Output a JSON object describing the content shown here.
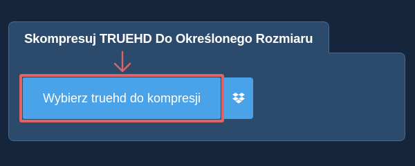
{
  "tab": {
    "title": "Skompresuj TRUEHD Do Określonego Rozmiaru"
  },
  "upload": {
    "button_label": "Wybierz truehd do kompresji"
  },
  "icons": {
    "annotation": "down-arrow-icon",
    "cloud": "dropbox-icon"
  },
  "colors": {
    "background": "#15253b",
    "panel": "#2c4a6b",
    "button": "#4aa3e8",
    "highlight": "#e06464"
  }
}
